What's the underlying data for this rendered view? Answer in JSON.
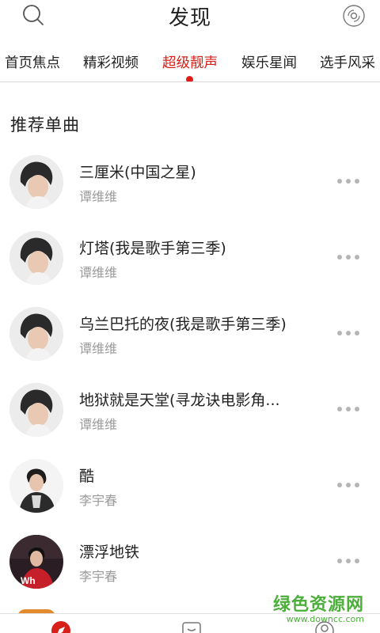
{
  "header": {
    "title": "发现"
  },
  "tabs": [
    {
      "label": "首页焦点",
      "active": false
    },
    {
      "label": "精彩视频",
      "active": false
    },
    {
      "label": "超级靓声",
      "active": true
    },
    {
      "label": "娱乐星闻",
      "active": false
    },
    {
      "label": "选手风采",
      "active": false
    }
  ],
  "section": {
    "title": "推荐单曲"
  },
  "songs": [
    {
      "name": "三厘米(中国之星)",
      "artist": "谭维维"
    },
    {
      "name": "灯塔(我是歌手第三季)",
      "artist": "谭维维"
    },
    {
      "name": "乌兰巴托的夜(我是歌手第三季)",
      "artist": "谭维维"
    },
    {
      "name": "地狱就是天堂(寻龙诀电影角...",
      "artist": "谭维维"
    },
    {
      "name": "酷",
      "artist": "李宇春"
    },
    {
      "name": "漂浮地铁",
      "artist": "李宇春"
    }
  ],
  "watermark": {
    "main": "绿色资源网",
    "url": "www.downcc.com"
  },
  "colors": {
    "accent": "#d7201a",
    "dot": "#e21a1a",
    "secondary_text": "#9a9a9a",
    "watermark": "#4caf3c"
  }
}
